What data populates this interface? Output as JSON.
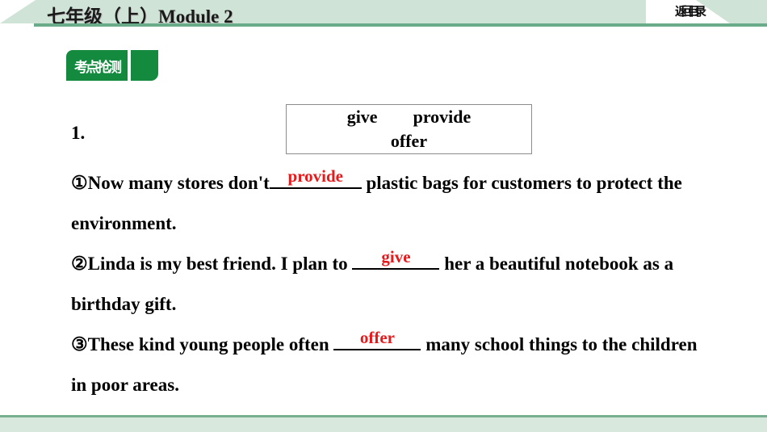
{
  "header": {
    "title": "七年级（上）Module 2",
    "back_button": "返回目录"
  },
  "section": {
    "tab_label": "考点抢测"
  },
  "exercise": {
    "number": "1.",
    "word_bank": {
      "line1": [
        "give",
        "provide"
      ],
      "line2": [
        "offer"
      ]
    },
    "items": [
      {
        "marker": "①",
        "text_before": "Now many stores don't",
        "answer": "provide",
        "text_after": " plastic bags for customers to protect the environment."
      },
      {
        "marker": "②",
        "text_before": "Linda is my best friend. I plan to ",
        "answer": "give",
        "text_after": " her a beautiful notebook as a birthday gift."
      },
      {
        "marker": "③",
        "text_before": "These kind young people often ",
        "answer": "offer",
        "text_after": " many school things to the children in poor areas."
      }
    ]
  },
  "colors": {
    "header_band": "#cfe4d7",
    "header_rule": "#6aab8a",
    "tab_green": "#138a3e",
    "answer_red": "#e8191b",
    "footer_bg": "#d8e8dd",
    "footer_border": "#77b091"
  }
}
